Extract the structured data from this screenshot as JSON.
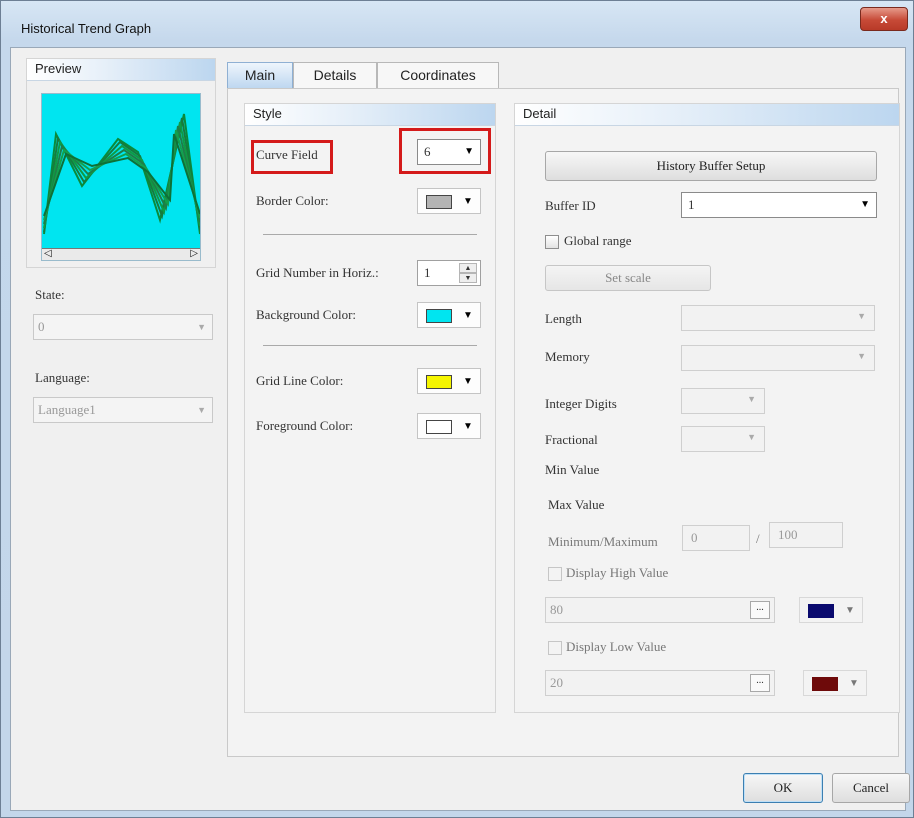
{
  "window": {
    "title": "Historical Trend Graph",
    "close_glyph": "x"
  },
  "preview": {
    "header": "Preview",
    "scroll_left": "◁",
    "scroll_right": "▷",
    "state_label": "State:",
    "state_value": "0",
    "language_label": "Language:",
    "language_value": "Language1"
  },
  "tabs": [
    {
      "label": "Main",
      "active": true
    },
    {
      "label": "Details",
      "active": false
    },
    {
      "label": "Coordinates",
      "active": false
    }
  ],
  "style": {
    "header": "Style",
    "curve_field_label": "Curve Field",
    "curve_field_value": "6",
    "border_color_label": "Border Color:",
    "border_color": "#b4b4b4",
    "grid_number_label": "Grid Number in Horiz.:",
    "grid_number_value": "1",
    "background_color_label": "Background Color:",
    "background_color": "#00e5f0",
    "grid_line_color_label": "Grid Line Color:",
    "grid_line_color": "#f5f500",
    "foreground_color_label": "Foreground Color:",
    "foreground_color": "#ffffff"
  },
  "detail": {
    "header": "Detail",
    "history_buffer_button": "History Buffer Setup",
    "buffer_id_label": "Buffer ID",
    "buffer_id_value": "1",
    "global_range_label": "Global range",
    "set_scale_button": "Set scale",
    "length_label": "Length",
    "memory_label": "Memory",
    "integer_digits_label": "Integer Digits",
    "fractional_label": "Fractional",
    "min_value_label": "Min Value",
    "max_value_label": "Max Value",
    "min_max_label": "Minimum/Maximum",
    "minimum_value": "0",
    "separator": "/",
    "maximum_value": "100",
    "display_high_label": "Display High Value",
    "high_value": "80",
    "high_color": "#0a0a6e",
    "display_low_label": "Display Low Value",
    "low_value": "20",
    "low_color": "#6e0a0a",
    "browse_glyph": "..."
  },
  "footer": {
    "ok_label": "OK",
    "cancel_label": "Cancel"
  },
  "colors": {
    "highlight": "#d41a1a",
    "accent": "#bcd6ef"
  }
}
